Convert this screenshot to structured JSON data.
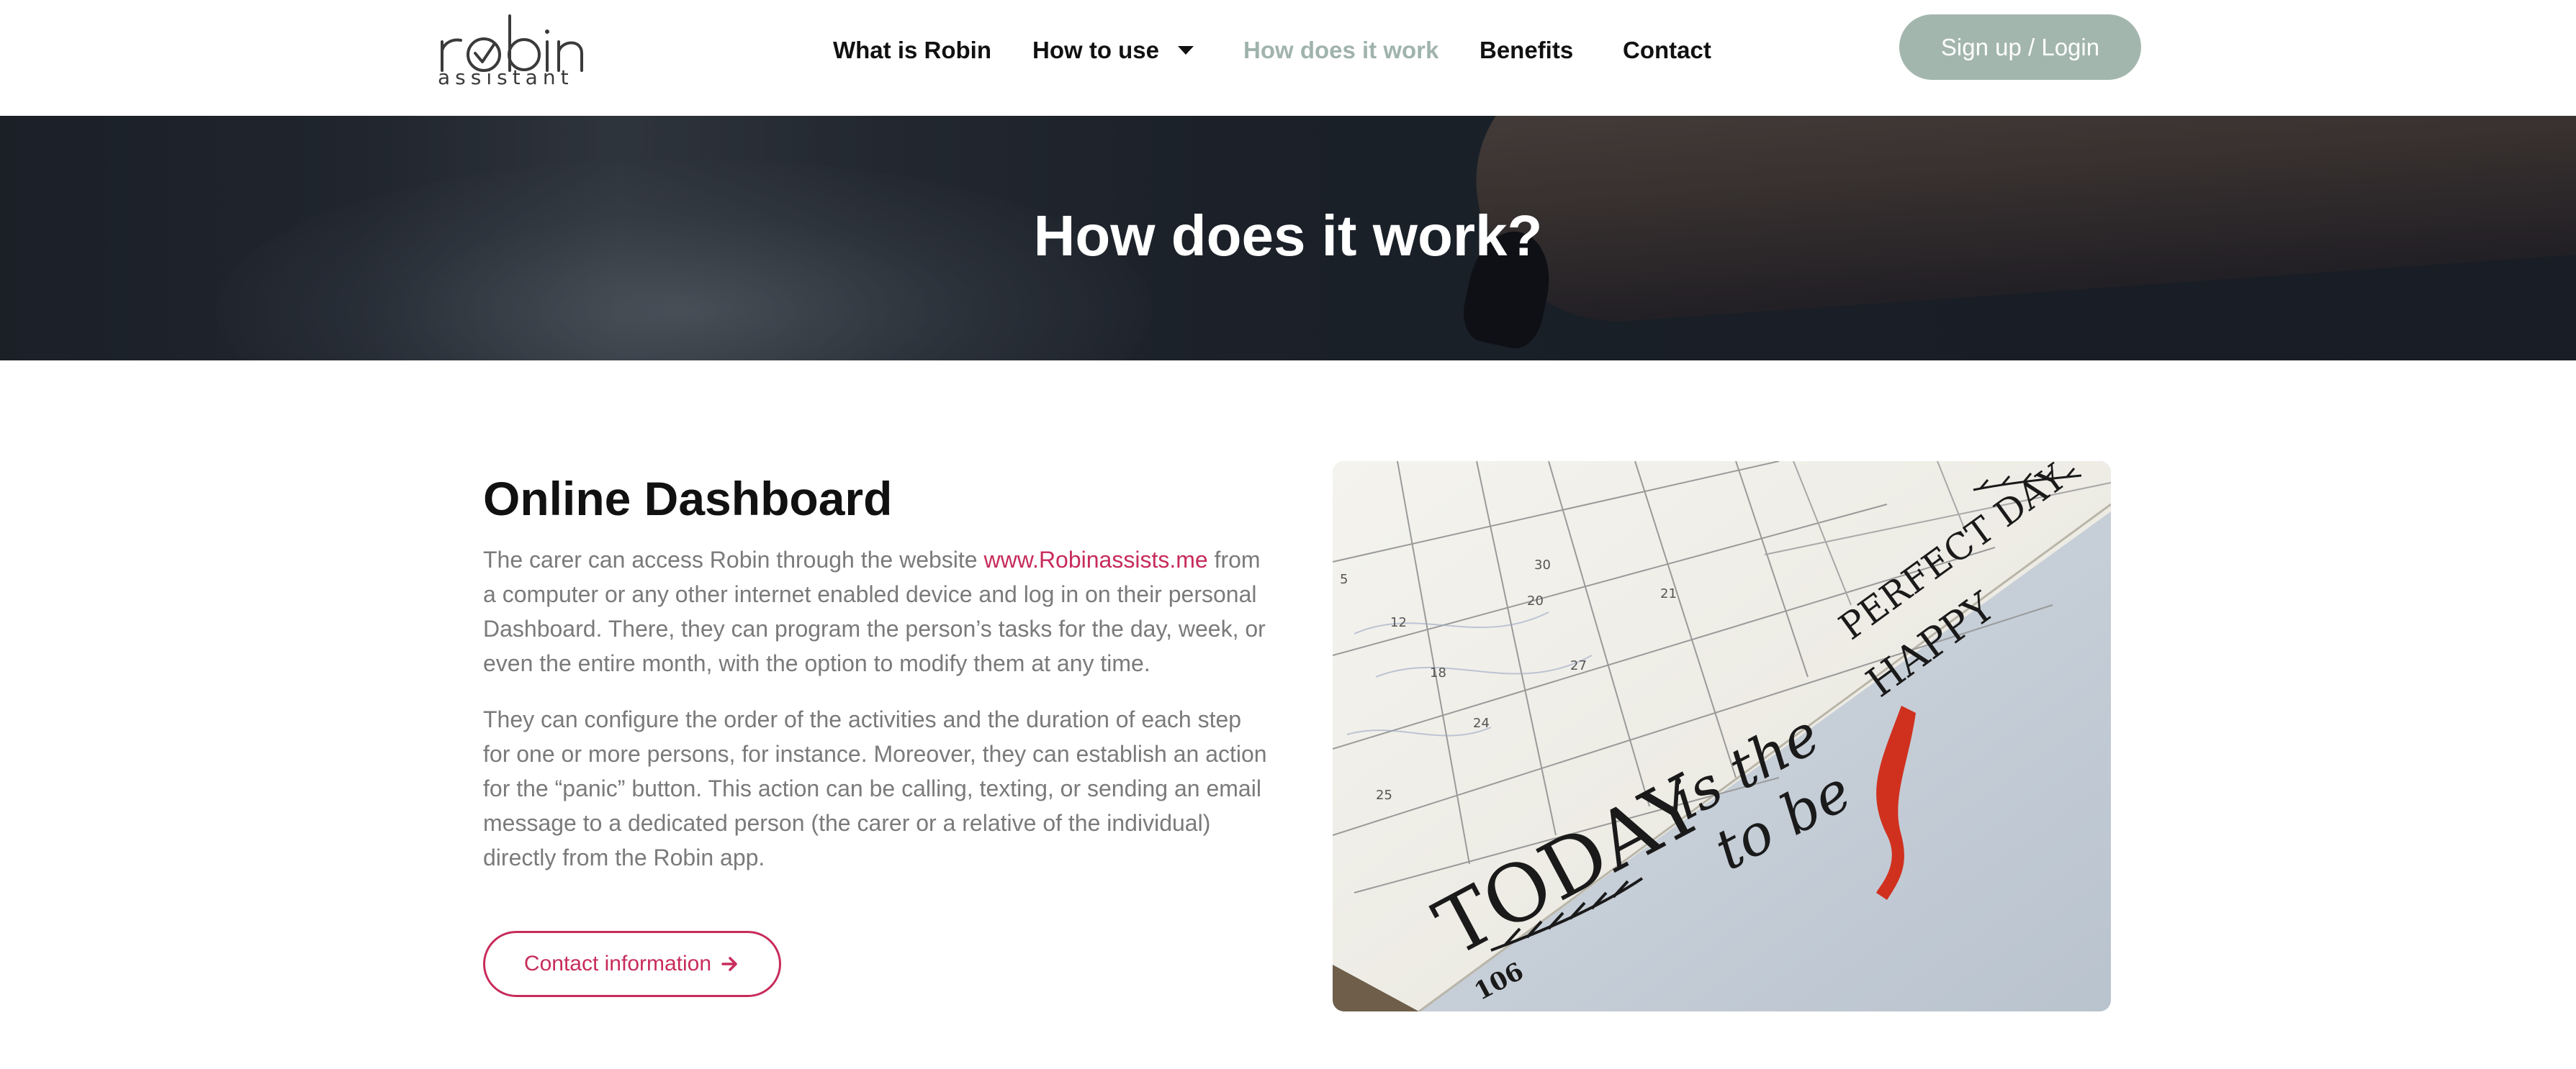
{
  "header": {
    "logo": {
      "wordmark": "robin",
      "sub": "assistant"
    },
    "nav": {
      "what_is_robin": "What is Robin",
      "how_to_use": "How to use",
      "how_does_it_work": "How does it work",
      "benefits": "Benefits",
      "contact": "Contact"
    },
    "login_label": "Sign up / Login"
  },
  "hero": {
    "title": "How does it work?"
  },
  "main": {
    "section_title": "Online Dashboard",
    "para1_before": "The carer can access Robin through the website ",
    "para1_link": "www.Robinassists.me",
    "para1_after": " from a computer or any other internet enabled device and log in on their personal Dashboard. There, they can program the person’s tasks for the day, week, or even the entire month, with the option to modify them at any time.",
    "para2": "They can configure the order of the activities and the duration of each step for one or more persons, for instance. Moreover, they can establish an action for the “panic” button. This action can be calling, texting, or sending an email message to a dedicated person (the carer or a relative of the individual) directly from the Robin app.",
    "contact_button_label": "Contact information"
  },
  "photo": {
    "lines": [
      "TODAY",
      "is the",
      "to be",
      "PERFECT DAY",
      "HAPPY"
    ],
    "page_number": "106",
    "calendar_numbers": [
      "5",
      "12",
      "18",
      "20",
      "21",
      "24",
      "25",
      "27",
      "30"
    ]
  },
  "colors": {
    "accent": "#c72c5b",
    "nav_active": "#a0b3ad",
    "login_bg": "#a3b6ae",
    "body_text": "#7a7a7a"
  },
  "icons": {
    "nav_dropdown": "caret-down-icon",
    "contact_arrow": "arrow-right-icon"
  }
}
